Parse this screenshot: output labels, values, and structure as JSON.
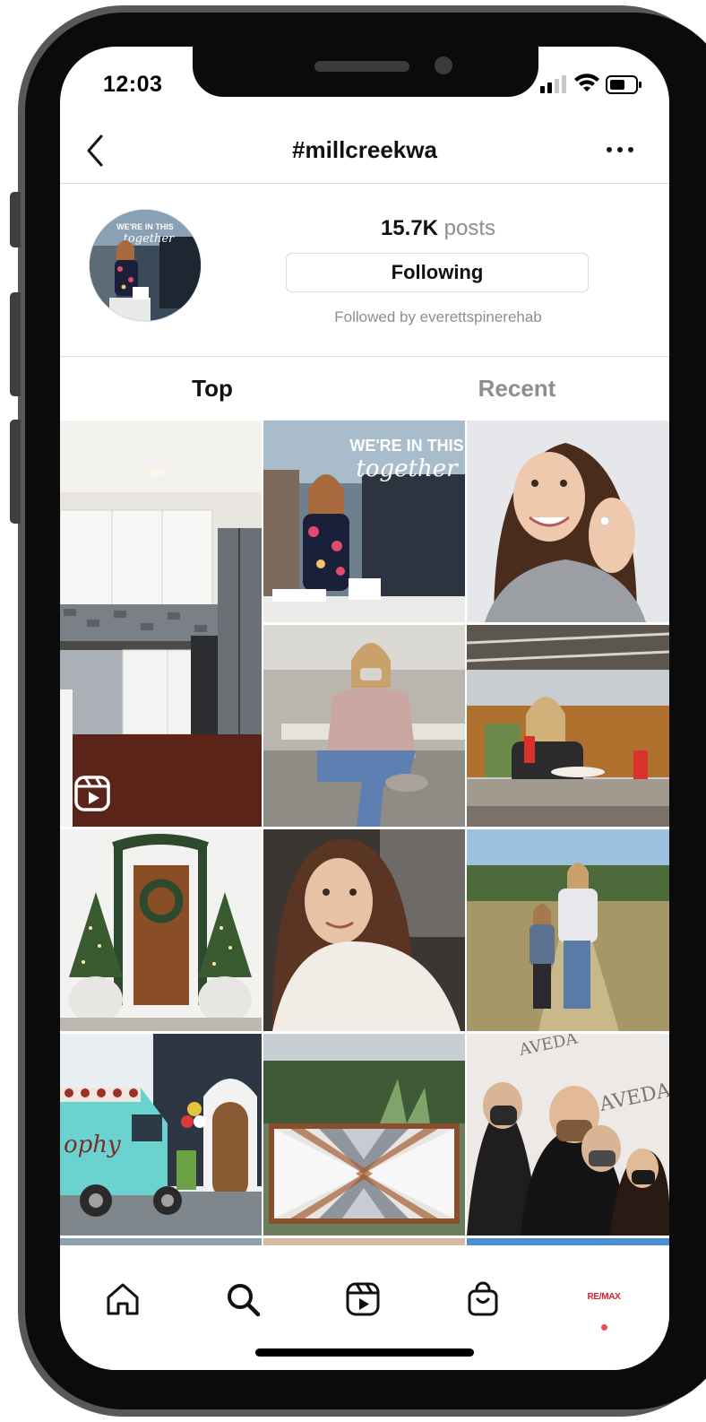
{
  "status_bar": {
    "time": "12:03"
  },
  "header": {
    "title": "#millcreekwa"
  },
  "profile": {
    "posts_count": "15.7K",
    "posts_label": "posts",
    "following_button": "Following",
    "followed_by": "Followed by everettspinerehab",
    "avatar_text_line1": "WE'RE IN THIS",
    "avatar_text_line2": "together"
  },
  "tabs": [
    {
      "label": "Top",
      "active": true
    },
    {
      "label": "Recent",
      "active": false
    }
  ],
  "grid": {
    "posts": [
      {
        "subject": "white kitchen interior",
        "type": "reel"
      },
      {
        "subject": "woman at storefront window",
        "overlay_line1": "WE'RE IN THIS",
        "overlay_line2": "together"
      },
      {
        "subject": "woman showing engagement ring"
      },
      {
        "subject": "woman in mask sitting on bench"
      },
      {
        "subject": "woman with drink on patio"
      },
      {
        "subject": "front door with christmas trees"
      },
      {
        "subject": "woman in white sweater in car"
      },
      {
        "subject": "two people on trail"
      },
      {
        "subject": "teal food truck",
        "truck_text": "ophy"
      },
      {
        "subject": "geometric wood art"
      },
      {
        "subject": "group in masks at salon",
        "sign_text": "AVEDA"
      }
    ]
  },
  "bottom_nav": {
    "items": [
      "home-icon",
      "search-icon",
      "reels-icon",
      "shop-icon",
      "profile-avatar"
    ],
    "profile_text": "RE/MAX"
  },
  "colors": {
    "text_primary": "#111111",
    "text_secondary": "#8e8e8e",
    "divider": "#dbdbdb",
    "notification_dot": "#ed4956",
    "remax_red": "#d2232a"
  }
}
